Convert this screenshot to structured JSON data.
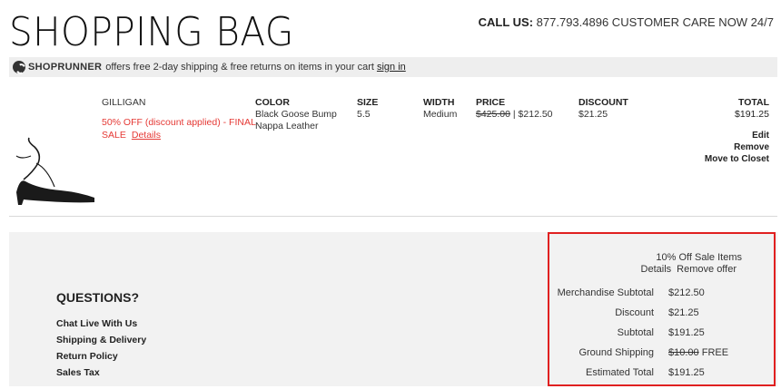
{
  "header": {
    "title": "SHOPPING BAG",
    "call_label": "CALL US:",
    "call_text": "877.793.4896 CUSTOMER CARE NOW 24/7"
  },
  "shoprunner": {
    "brand": "SHOPRUNNER",
    "text": "offers free 2-day shipping & free returns on items in your cart",
    "link": "sign in"
  },
  "item": {
    "name": "GILLIGAN",
    "sale_text": "50% OFF (discount applied) - FINAL SALE",
    "details_link": "Details",
    "columns": {
      "color_label": "COLOR",
      "size_label": "SIZE",
      "width_label": "WIDTH",
      "price_label": "PRICE",
      "discount_label": "DISCOUNT",
      "total_label": "TOTAL"
    },
    "color": "Black Goose Bump Nappa Leather",
    "size": "5.5",
    "width": "Medium",
    "price_original": "$425.00",
    "price_separator": "|",
    "price_current": "$212.50",
    "discount": "$21.25",
    "total": "$191.25",
    "actions": [
      "Edit",
      "Remove",
      "Move to Closet"
    ]
  },
  "questions": {
    "title": "QUESTIONS?",
    "links": [
      "Chat Live With Us",
      "Shipping & Delivery",
      "Return Policy",
      "Sales Tax"
    ]
  },
  "summary": {
    "promo_name": "10% Off Sale Items",
    "promo_details": "Details",
    "promo_remove": "Remove offer",
    "merch_label": "Merchandise Subtotal",
    "merch_value": "$212.50",
    "discount_label": "Discount",
    "discount_value": "$21.25",
    "subtotal_label": "Subtotal",
    "subtotal_value": "$191.25",
    "shipping_label": "Ground Shipping",
    "shipping_original": "$10.00",
    "shipping_value": "FREE",
    "total_label": "Estimated Total",
    "total_value": "$191.25"
  },
  "colors": {
    "sale_red": "#e53935",
    "highlight_border": "#e02020",
    "panel_bg": "#f2f2f2"
  }
}
